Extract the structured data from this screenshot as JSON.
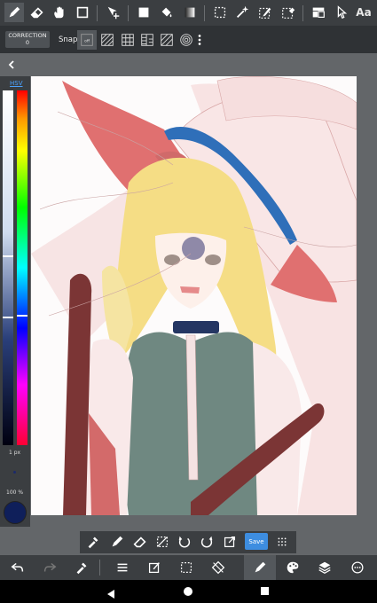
{
  "top_toolbar": {
    "items": [
      "pen-tool",
      "eraser-tool",
      "hand-tool",
      "rectangle-tool",
      "move-tool",
      "fill-shape-tool",
      "bucket-tool",
      "gradient-tool",
      "selection-tool",
      "magic-wand-tool",
      "select-pen-tool",
      "select-eraser-tool",
      "layer-tool",
      "pointer-tool"
    ],
    "text_tool_label": "Aa"
  },
  "sub_toolbar": {
    "correction_label": "CORRECTION",
    "correction_value": "0",
    "snap_label": "Snap",
    "snap_options": [
      "snap-off",
      "snap-parallel",
      "snap-grid",
      "snap-perspective-grid",
      "snap-diagonal",
      "snap-concentric",
      "more"
    ]
  },
  "color_panel": {
    "mode_label": "HSV",
    "brush_size": "1 px",
    "opacity": "100 %",
    "current_color": "#0f1f5a"
  },
  "quick_toolbar": {
    "save_label": "Save"
  },
  "bottom_toolbar": {
    "items": [
      "undo",
      "redo",
      "eyedropper",
      "menu",
      "edit",
      "selection",
      "transform",
      "pen",
      "palette",
      "layers",
      "settings"
    ]
  }
}
